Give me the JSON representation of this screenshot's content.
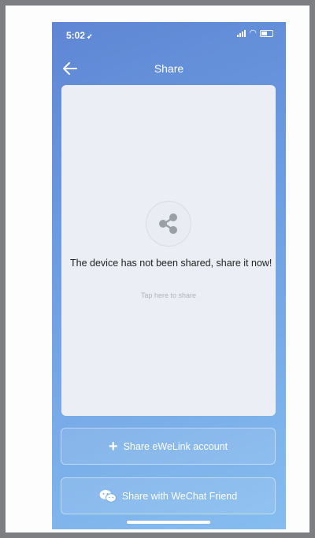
{
  "status_bar": {
    "time": "5:02",
    "location_arrow": "location-arrow-icon",
    "signal": "signal-icon",
    "wifi": "wifi-icon",
    "battery": "battery-icon"
  },
  "nav": {
    "title": "Share",
    "back_icon": "back-arrow-icon"
  },
  "card": {
    "share_icon": "share-icon",
    "message": "The device has not been shared, share it now!",
    "tap_hint": "Tap here to share"
  },
  "buttons": {
    "ewelink": {
      "label": "Share eWeLink account",
      "icon": "plus-icon"
    },
    "wechat": {
      "label": "Share with WeChat Friend",
      "icon": "wechat-icon"
    }
  },
  "colors": {
    "background_top": "#5f86d3",
    "background_bottom": "#86bdf0",
    "card": "#ebeef4",
    "page": "#7d7e81"
  }
}
